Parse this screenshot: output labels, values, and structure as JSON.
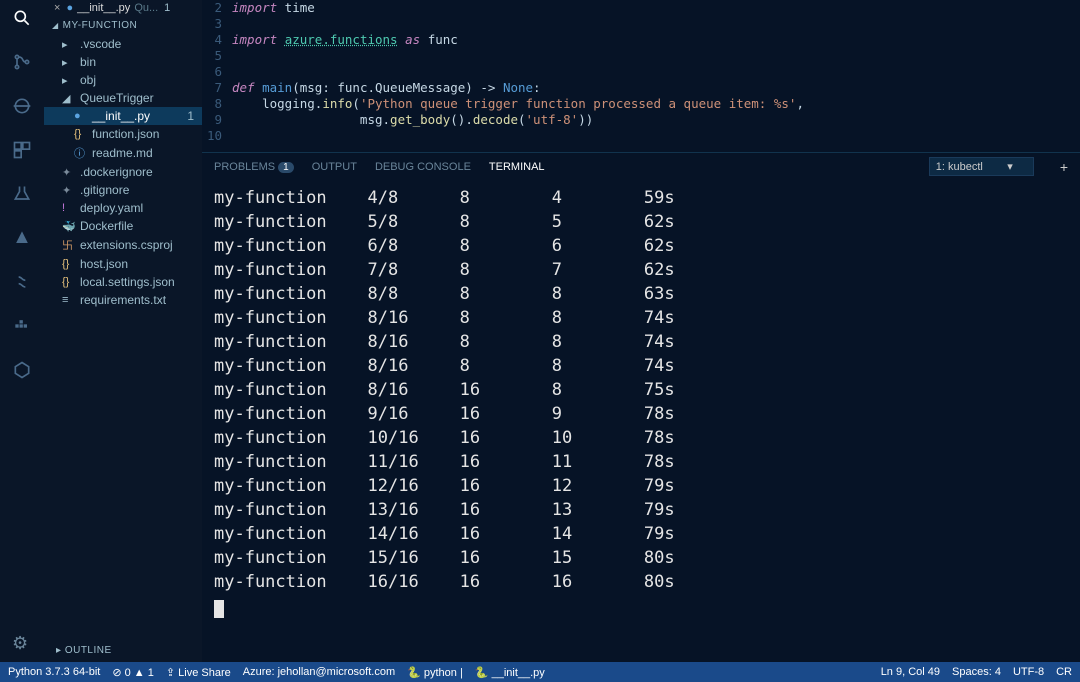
{
  "tabbar": {
    "close": "×",
    "modified": "●",
    "name": "__init__.py",
    "hint": "Qu...",
    "badge": "1"
  },
  "explorer": {
    "root": "MY-FUNCTION",
    "items": [
      {
        "icon": "▸",
        "label": ".vscode",
        "i": 1,
        "color": ""
      },
      {
        "icon": "▸",
        "label": "bin",
        "i": 1,
        "color": ""
      },
      {
        "icon": "▸",
        "label": "obj",
        "i": 1,
        "color": ""
      },
      {
        "icon": "◢",
        "label": "QueueTrigger",
        "i": 1,
        "color": ""
      },
      {
        "icon": "",
        "label": "__init__.py",
        "i": 2,
        "color": "#5aa3e0",
        "sel": true,
        "pre": "●",
        "badge": "1"
      },
      {
        "icon": "{}",
        "label": "function.json",
        "i": 2,
        "color": "#e5c07b"
      },
      {
        "icon": "ⓘ",
        "label": "readme.md",
        "i": 2,
        "color": "#61afef"
      },
      {
        "icon": "✦",
        "label": ".dockerignore",
        "i": 1,
        "color": "#7a8a9a"
      },
      {
        "icon": "✦",
        "label": ".gitignore",
        "i": 1,
        "color": "#7a8a9a"
      },
      {
        "icon": "!",
        "label": "deploy.yaml",
        "i": 1,
        "color": "#c678dd"
      },
      {
        "icon": "",
        "label": "Dockerfile",
        "i": 1,
        "color": "#61afef",
        "pre": "🐳"
      },
      {
        "icon": "",
        "label": "extensions.csproj",
        "i": 1,
        "color": "#d19a66",
        "pre": "卐"
      },
      {
        "icon": "{}",
        "label": "host.json",
        "i": 1,
        "color": "#e5c07b"
      },
      {
        "icon": "{}",
        "label": "local.settings.json",
        "i": 1,
        "color": "#e5c07b"
      },
      {
        "icon": "≡",
        "label": "requirements.txt",
        "i": 1,
        "color": "#9fbecc"
      }
    ],
    "outline": "OUTLINE"
  },
  "editor_lines": [
    {
      "n": "2",
      "t": [
        "import",
        " time"
      ],
      "c": [
        "kw",
        ""
      ]
    },
    {
      "n": "3",
      "t": [
        ""
      ],
      "c": [
        ""
      ]
    },
    {
      "n": "4",
      "t": [
        "import ",
        "azure.functions",
        " ",
        "as",
        " func"
      ],
      "c": [
        "kw",
        "mod und",
        "",
        "kw",
        ""
      ]
    },
    {
      "n": "5",
      "t": [
        ""
      ],
      "c": [
        ""
      ]
    },
    {
      "n": "6",
      "t": [
        ""
      ],
      "c": [
        ""
      ]
    },
    {
      "n": "7",
      "t": [
        "def ",
        "main",
        "(msg: func.QueueMessage) -> ",
        "None",
        ":"
      ],
      "c": [
        "kw",
        "fn2",
        "",
        "none",
        ""
      ]
    },
    {
      "n": "8",
      "t": [
        "    logging.",
        "info",
        "(",
        "'Python queue trigger function processed a queue item: %s'",
        ","
      ],
      "c": [
        "",
        "fn",
        "",
        "str",
        ""
      ]
    },
    {
      "n": "9",
      "t": [
        "                 msg.",
        "get_body",
        "().",
        "decode",
        "(",
        "'utf-8'",
        "))"
      ],
      "c": [
        "",
        "fn",
        "",
        "fn",
        "",
        "str",
        ""
      ]
    },
    {
      "n": "10",
      "t": [
        ""
      ],
      "c": [
        ""
      ]
    }
  ],
  "panel": {
    "tabs": [
      "PROBLEMS",
      "OUTPUT",
      "DEBUG CONSOLE",
      "TERMINAL"
    ],
    "problems_badge": "1",
    "active": "TERMINAL",
    "selector": "1: kubectl"
  },
  "terminal_rows": [
    [
      "my-function",
      "4/8",
      "8",
      "4",
      "59s"
    ],
    [
      "my-function",
      "5/8",
      "8",
      "5",
      "62s"
    ],
    [
      "my-function",
      "6/8",
      "8",
      "6",
      "62s"
    ],
    [
      "my-function",
      "7/8",
      "8",
      "7",
      "62s"
    ],
    [
      "my-function",
      "8/8",
      "8",
      "8",
      "63s"
    ],
    [
      "my-function",
      "8/16",
      "8",
      "8",
      "74s"
    ],
    [
      "my-function",
      "8/16",
      "8",
      "8",
      "74s"
    ],
    [
      "my-function",
      "8/16",
      "8",
      "8",
      "74s"
    ],
    [
      "my-function",
      "8/16",
      "16",
      "8",
      "75s"
    ],
    [
      "my-function",
      "9/16",
      "16",
      "9",
      "78s"
    ],
    [
      "my-function",
      "10/16",
      "16",
      "10",
      "78s"
    ],
    [
      "my-function",
      "11/16",
      "16",
      "11",
      "78s"
    ],
    [
      "my-function",
      "12/16",
      "16",
      "12",
      "79s"
    ],
    [
      "my-function",
      "13/16",
      "16",
      "13",
      "79s"
    ],
    [
      "my-function",
      "14/16",
      "16",
      "14",
      "79s"
    ],
    [
      "my-function",
      "15/16",
      "16",
      "15",
      "80s"
    ],
    [
      "my-function",
      "16/16",
      "16",
      "16",
      "80s"
    ]
  ],
  "status": {
    "python": "Python 3.7.3 64-bit",
    "errs": "⊘ 0 ▲ 1",
    "liveshare": "⇪ Live Share",
    "azure": "Azure: jehollan@microsoft.com",
    "venv": "🐍 python |",
    "file": "🐍 __init__.py",
    "pos": "Ln 9, Col 49",
    "spaces": "Spaces: 4",
    "enc": "UTF-8",
    "eol": "CR"
  }
}
